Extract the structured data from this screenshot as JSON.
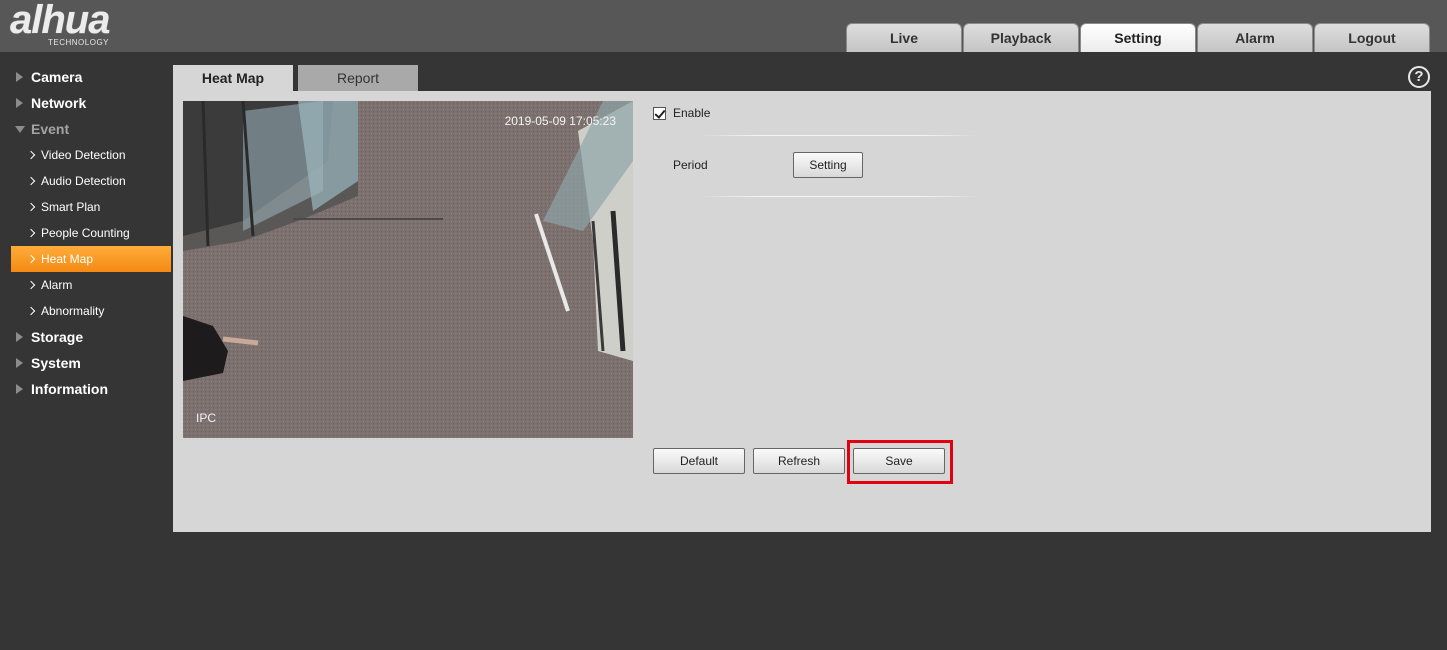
{
  "header": {
    "logo_text": "alhua",
    "logo_subtext": "TECHNOLOGY",
    "nav": [
      {
        "label": "Live",
        "active": false
      },
      {
        "label": "Playback",
        "active": false
      },
      {
        "label": "Setting",
        "active": true
      },
      {
        "label": "Alarm",
        "active": false
      },
      {
        "label": "Logout",
        "active": false
      }
    ]
  },
  "sidebar": {
    "items": [
      {
        "label": "Camera",
        "level": 1
      },
      {
        "label": "Network",
        "level": 1
      },
      {
        "label": "Event",
        "level": 1,
        "expanded": true
      },
      {
        "label": "Video Detection",
        "level": 2
      },
      {
        "label": "Audio Detection",
        "level": 2
      },
      {
        "label": "Smart Plan",
        "level": 2
      },
      {
        "label": "People Counting",
        "level": 2
      },
      {
        "label": "Heat Map",
        "level": 2,
        "active": true
      },
      {
        "label": "Alarm",
        "level": 2
      },
      {
        "label": "Abnormality",
        "level": 2
      },
      {
        "label": "Storage",
        "level": 1
      },
      {
        "label": "System",
        "level": 1
      },
      {
        "label": "Information",
        "level": 1
      }
    ]
  },
  "tabs": [
    {
      "label": "Heat Map",
      "active": true
    },
    {
      "label": "Report",
      "active": false
    }
  ],
  "help_symbol": "?",
  "video": {
    "timestamp": "2019-05-09 17:05:23",
    "osd_name": "IPC"
  },
  "form": {
    "enable_label": "Enable",
    "enable_checked": true,
    "period_label": "Period",
    "period_button": "Setting"
  },
  "actions": {
    "default_label": "Default",
    "refresh_label": "Refresh",
    "save_label": "Save"
  },
  "colors": {
    "accent": "#f4901c",
    "highlight": "#e0000f",
    "panel": "#d6d6d6",
    "background": "#353535"
  }
}
